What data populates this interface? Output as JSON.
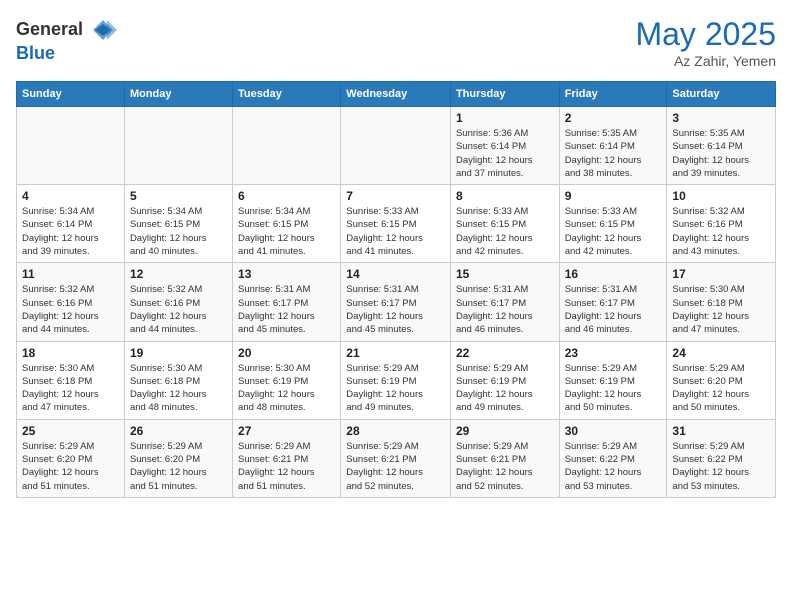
{
  "header": {
    "logo_line1": "General",
    "logo_line2": "Blue",
    "month_title": "May 2025",
    "location": "Az Zahir, Yemen"
  },
  "days_of_week": [
    "Sunday",
    "Monday",
    "Tuesday",
    "Wednesday",
    "Thursday",
    "Friday",
    "Saturday"
  ],
  "weeks": [
    [
      {
        "day": "",
        "info": ""
      },
      {
        "day": "",
        "info": ""
      },
      {
        "day": "",
        "info": ""
      },
      {
        "day": "",
        "info": ""
      },
      {
        "day": "1",
        "info": "Sunrise: 5:36 AM\nSunset: 6:14 PM\nDaylight: 12 hours\nand 37 minutes."
      },
      {
        "day": "2",
        "info": "Sunrise: 5:35 AM\nSunset: 6:14 PM\nDaylight: 12 hours\nand 38 minutes."
      },
      {
        "day": "3",
        "info": "Sunrise: 5:35 AM\nSunset: 6:14 PM\nDaylight: 12 hours\nand 39 minutes."
      }
    ],
    [
      {
        "day": "4",
        "info": "Sunrise: 5:34 AM\nSunset: 6:14 PM\nDaylight: 12 hours\nand 39 minutes."
      },
      {
        "day": "5",
        "info": "Sunrise: 5:34 AM\nSunset: 6:15 PM\nDaylight: 12 hours\nand 40 minutes."
      },
      {
        "day": "6",
        "info": "Sunrise: 5:34 AM\nSunset: 6:15 PM\nDaylight: 12 hours\nand 41 minutes."
      },
      {
        "day": "7",
        "info": "Sunrise: 5:33 AM\nSunset: 6:15 PM\nDaylight: 12 hours\nand 41 minutes."
      },
      {
        "day": "8",
        "info": "Sunrise: 5:33 AM\nSunset: 6:15 PM\nDaylight: 12 hours\nand 42 minutes."
      },
      {
        "day": "9",
        "info": "Sunrise: 5:33 AM\nSunset: 6:15 PM\nDaylight: 12 hours\nand 42 minutes."
      },
      {
        "day": "10",
        "info": "Sunrise: 5:32 AM\nSunset: 6:16 PM\nDaylight: 12 hours\nand 43 minutes."
      }
    ],
    [
      {
        "day": "11",
        "info": "Sunrise: 5:32 AM\nSunset: 6:16 PM\nDaylight: 12 hours\nand 44 minutes."
      },
      {
        "day": "12",
        "info": "Sunrise: 5:32 AM\nSunset: 6:16 PM\nDaylight: 12 hours\nand 44 minutes."
      },
      {
        "day": "13",
        "info": "Sunrise: 5:31 AM\nSunset: 6:17 PM\nDaylight: 12 hours\nand 45 minutes."
      },
      {
        "day": "14",
        "info": "Sunrise: 5:31 AM\nSunset: 6:17 PM\nDaylight: 12 hours\nand 45 minutes."
      },
      {
        "day": "15",
        "info": "Sunrise: 5:31 AM\nSunset: 6:17 PM\nDaylight: 12 hours\nand 46 minutes."
      },
      {
        "day": "16",
        "info": "Sunrise: 5:31 AM\nSunset: 6:17 PM\nDaylight: 12 hours\nand 46 minutes."
      },
      {
        "day": "17",
        "info": "Sunrise: 5:30 AM\nSunset: 6:18 PM\nDaylight: 12 hours\nand 47 minutes."
      }
    ],
    [
      {
        "day": "18",
        "info": "Sunrise: 5:30 AM\nSunset: 6:18 PM\nDaylight: 12 hours\nand 47 minutes."
      },
      {
        "day": "19",
        "info": "Sunrise: 5:30 AM\nSunset: 6:18 PM\nDaylight: 12 hours\nand 48 minutes."
      },
      {
        "day": "20",
        "info": "Sunrise: 5:30 AM\nSunset: 6:19 PM\nDaylight: 12 hours\nand 48 minutes."
      },
      {
        "day": "21",
        "info": "Sunrise: 5:29 AM\nSunset: 6:19 PM\nDaylight: 12 hours\nand 49 minutes."
      },
      {
        "day": "22",
        "info": "Sunrise: 5:29 AM\nSunset: 6:19 PM\nDaylight: 12 hours\nand 49 minutes."
      },
      {
        "day": "23",
        "info": "Sunrise: 5:29 AM\nSunset: 6:19 PM\nDaylight: 12 hours\nand 50 minutes."
      },
      {
        "day": "24",
        "info": "Sunrise: 5:29 AM\nSunset: 6:20 PM\nDaylight: 12 hours\nand 50 minutes."
      }
    ],
    [
      {
        "day": "25",
        "info": "Sunrise: 5:29 AM\nSunset: 6:20 PM\nDaylight: 12 hours\nand 51 minutes."
      },
      {
        "day": "26",
        "info": "Sunrise: 5:29 AM\nSunset: 6:20 PM\nDaylight: 12 hours\nand 51 minutes."
      },
      {
        "day": "27",
        "info": "Sunrise: 5:29 AM\nSunset: 6:21 PM\nDaylight: 12 hours\nand 51 minutes."
      },
      {
        "day": "28",
        "info": "Sunrise: 5:29 AM\nSunset: 6:21 PM\nDaylight: 12 hours\nand 52 minutes."
      },
      {
        "day": "29",
        "info": "Sunrise: 5:29 AM\nSunset: 6:21 PM\nDaylight: 12 hours\nand 52 minutes."
      },
      {
        "day": "30",
        "info": "Sunrise: 5:29 AM\nSunset: 6:22 PM\nDaylight: 12 hours\nand 53 minutes."
      },
      {
        "day": "31",
        "info": "Sunrise: 5:29 AM\nSunset: 6:22 PM\nDaylight: 12 hours\nand 53 minutes."
      }
    ]
  ]
}
